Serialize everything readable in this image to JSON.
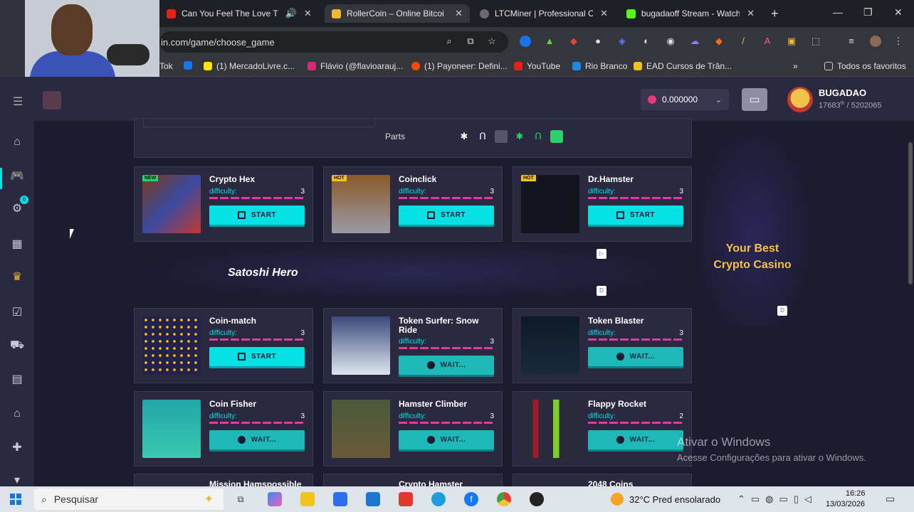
{
  "browser": {
    "tabs": [
      {
        "title": "Can You Feel The Love T",
        "active": false,
        "muted": true
      },
      {
        "title": "RollerCoin – Online Bitcoin M",
        "active": true
      },
      {
        "title": "LTCMiner | Professional Clou",
        "active": false
      },
      {
        "title": "bugadaoff Stream - Watch L",
        "active": false
      }
    ],
    "url": "in.com/game/choose_game",
    "bookmarks": [
      "Tok",
      "(1) MercadoLivre.c...",
      "Flávio (@flavioarauj...",
      "(1) Payoneer: Defini...",
      "YouTube",
      "Rio Branco",
      "EAD Cursos de Trân..."
    ],
    "all_bookmarks": "Todos os favoritos"
  },
  "header": {
    "balance": "0.000000",
    "currency_icon": "rlt-coin-icon",
    "username": "BUGADAO",
    "rank_text": "17683",
    "rank_suffix": "th",
    "rank_total": " / 5202065"
  },
  "parts": {
    "label": "Parts"
  },
  "games_row1": [
    {
      "name": "Crypto Hex",
      "tag": "NEW",
      "difficulty": "3",
      "button": "START",
      "state": "start"
    },
    {
      "name": "Coinclick",
      "tag": "HOT",
      "difficulty": "3",
      "button": "START",
      "state": "start"
    },
    {
      "name": "Dr.Hamster",
      "tag": "HOT",
      "difficulty": "3",
      "button": "START",
      "state": "start"
    }
  ],
  "games_row2": [
    {
      "name": "Coin-match",
      "difficulty": "3",
      "button": "START",
      "state": "start"
    },
    {
      "name": "Token Surfer: Snow Ride",
      "difficulty": "3",
      "button": "WAIT...",
      "state": "wait"
    },
    {
      "name": "Token Blaster",
      "difficulty": "3",
      "button": "WAIT...",
      "state": "wait"
    }
  ],
  "games_row3": [
    {
      "name": "Coin Fisher",
      "difficulty": "3",
      "button": "WAIT...",
      "state": "wait"
    },
    {
      "name": "Hamster Climber",
      "difficulty": "3",
      "button": "WAIT...",
      "state": "wait"
    },
    {
      "name": "Flappy Rocket",
      "difficulty": "2",
      "button": "WAIT...",
      "state": "wait"
    }
  ],
  "games_row4": [
    "Mission Hamspossible",
    "Crypto Hamster",
    "2048 Coins"
  ],
  "difficulty_label": "difficulty:",
  "banner": {
    "title": "Satoshi Hero"
  },
  "side_ad": {
    "text": "Your Best Crypto Casino"
  },
  "watermark": {
    "line1": "Ativar o Windows",
    "line2": "Acesse Configurações para ativar o Windows."
  },
  "taskbar": {
    "search": "Pesquisar",
    "weather": "32°C  Pred ensolarado",
    "time": "16:26",
    "date": "13/03/2026"
  },
  "colors": {
    "accent": "#03e1e4",
    "bg": "#1c1b30",
    "panel": "#2b2940",
    "difficulty_bar": "#e63aa1"
  }
}
